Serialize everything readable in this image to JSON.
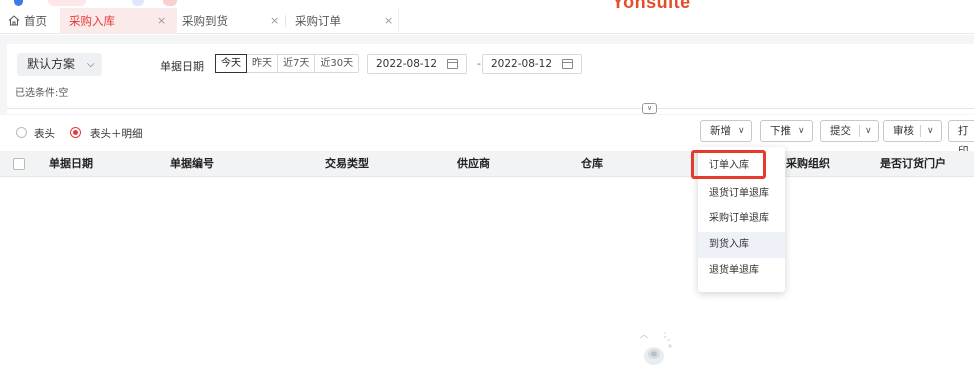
{
  "header": {
    "brand": "Yonsuite",
    "logo_colors": [
      "#3b7be6",
      "#f0b84a",
      "#f08a8a"
    ]
  },
  "tabs": {
    "home_label": "首页",
    "items": [
      {
        "label": "采购入库",
        "active": true
      },
      {
        "label": "采购到货",
        "active": false
      },
      {
        "label": "采购订单",
        "active": false
      }
    ],
    "close_glyph": "×"
  },
  "filter": {
    "scheme_label": "默认方案",
    "selected_conditions": "已选条件:空",
    "date_label": "单据日期",
    "quick_ranges": [
      "今天",
      "昨天",
      "近7天",
      "近30天"
    ],
    "selected_range": "今天",
    "date_from": "2022-08-12",
    "date_to": "2022-08-12",
    "date_separator": "-"
  },
  "view_options": {
    "header_only": "表头",
    "header_detail": "表头＋明细",
    "selected": "表头＋明细"
  },
  "toolbar": {
    "new_label": "新增",
    "push_label": "下推",
    "submit_label": "提交",
    "audit_label": "审核",
    "print_label": "打印"
  },
  "table": {
    "columns": [
      "单据日期",
      "单据编号",
      "交易类型",
      "供应商",
      "仓库",
      "采购组织",
      "是否订货门户"
    ]
  },
  "dropdown": {
    "items": [
      "订单入库",
      "退货订单退库",
      "采购订单退库",
      "到货入库",
      "退货单退库"
    ],
    "highlighted": "订单入库",
    "hovered": "到货入库"
  },
  "colors": {
    "accent": "#e5393b",
    "highlight_border": "#e53a2e",
    "active_tab_bg": "#fbeaea"
  }
}
